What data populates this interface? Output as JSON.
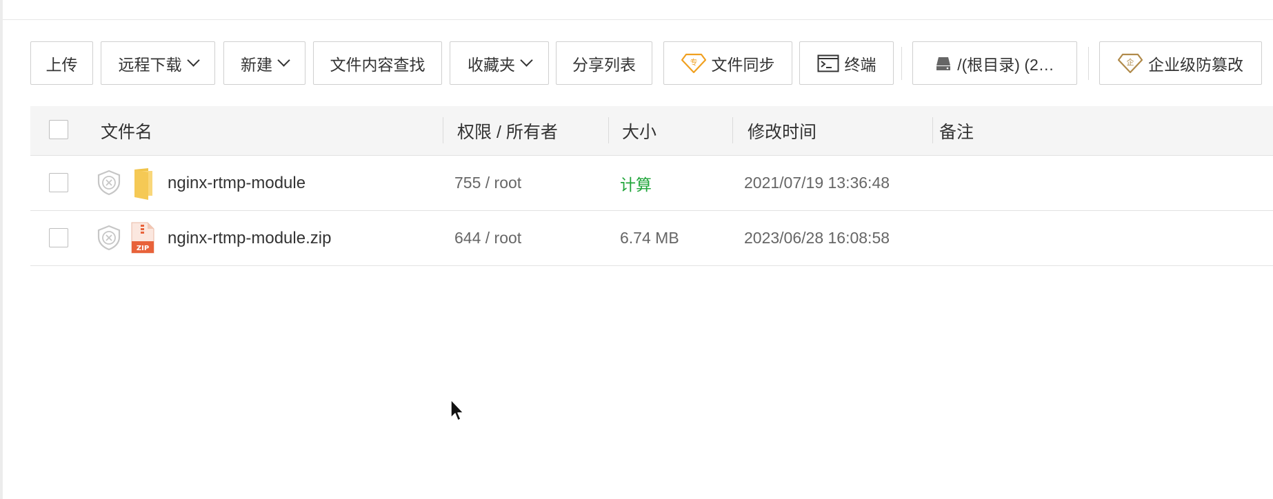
{
  "toolbar": {
    "upload": "上传",
    "remote_download": "远程下载",
    "new": "新建",
    "content_search": "文件内容查找",
    "favorites": "收藏夹",
    "share_list": "分享列表",
    "file_sync": "文件同步",
    "file_sync_badge": "专",
    "terminal": "终端",
    "disk": "/(根目录) (2…",
    "tamper_proof": "企业级防篡改",
    "tamper_proof_badge": "企"
  },
  "table": {
    "columns": {
      "name": "文件名",
      "perm_owner": "权限 / 所有者",
      "size": "大小",
      "mtime": "修改时间",
      "remark": "备注"
    },
    "rows": [
      {
        "name": "nginx-rtmp-module",
        "type": "folder",
        "perm_owner": "755 / root",
        "size": "计算",
        "mtime": "2021/07/19 13:36:48",
        "remark": ""
      },
      {
        "name": "nginx-rtmp-module.zip",
        "type": "zip",
        "perm_owner": "644 / root",
        "size": "6.74 MB",
        "mtime": "2023/06/28 16:08:58",
        "remark": "",
        "zip_label": "ZIP"
      }
    ]
  },
  "colors": {
    "accent_green": "#20a53a",
    "pro_orange": "#f0a020",
    "enterprise_gold": "#b08a4a"
  }
}
